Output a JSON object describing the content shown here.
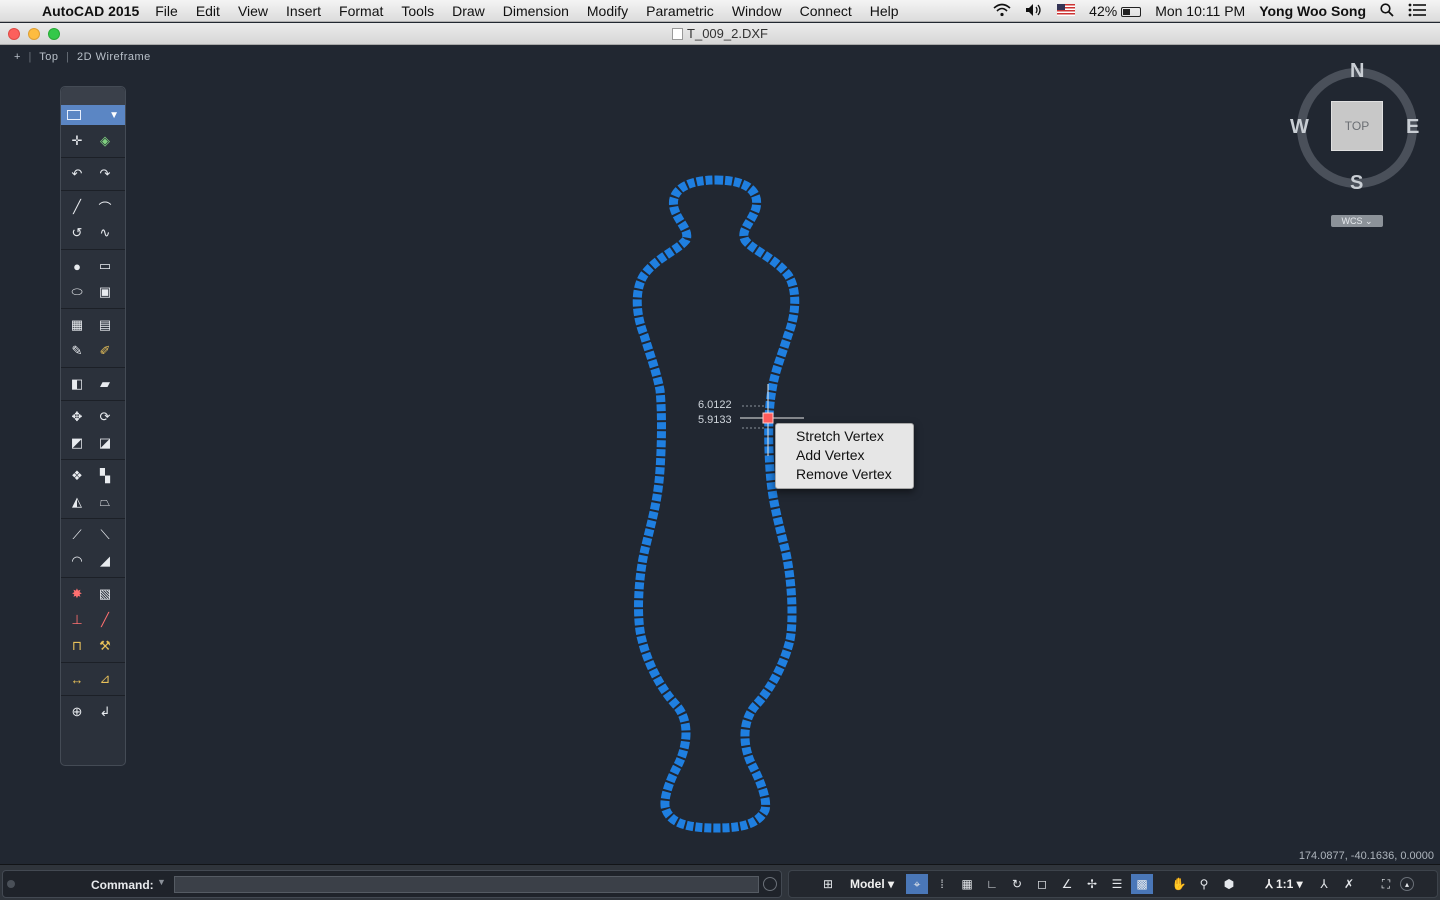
{
  "menubar": {
    "app_name": "AutoCAD 2015",
    "items": [
      "File",
      "Edit",
      "View",
      "Insert",
      "Format",
      "Tools",
      "Draw",
      "Dimension",
      "Modify",
      "Parametric",
      "Window",
      "Connect",
      "Help"
    ],
    "battery": "42%",
    "clock": "Mon 10:11 PM",
    "user": "Yong Woo Song",
    "battery_level": 0.42
  },
  "window": {
    "title": "T_009_2.DXF"
  },
  "viewport": {
    "controls": {
      "plus": "+",
      "view": "Top",
      "style": "2D Wireframe"
    }
  },
  "readout": {
    "line1": "6.0122",
    "line2": "5.9133"
  },
  "context_menu": {
    "items": [
      "Stretch Vertex",
      "Add Vertex",
      "Remove Vertex"
    ]
  },
  "viewcube": {
    "face": "TOP",
    "north": "N",
    "south": "S",
    "east": "E",
    "west": "W",
    "ucs": "WCS ⌄"
  },
  "coordinates": "174.0877, -40.1636, 0.0000",
  "command": {
    "label": "Command:"
  },
  "status": {
    "model_label": "Model ▾",
    "scale_label": "⅄ 1:1 ▾"
  },
  "colors": {
    "polyline": "#1f7fe0",
    "grip_hot": "#ff5a5a",
    "background": "#212731"
  }
}
